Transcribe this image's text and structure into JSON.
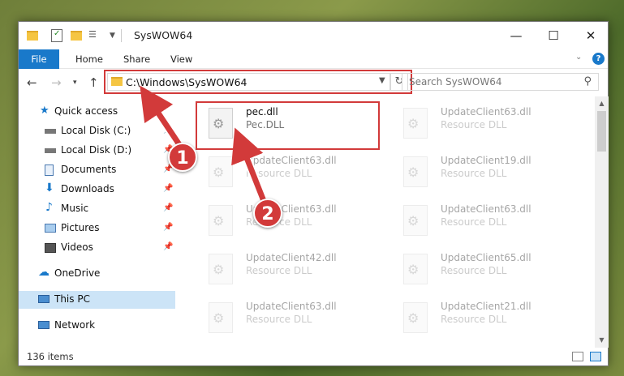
{
  "window": {
    "title": "SysWOW64",
    "minimize": "—",
    "maximize": "☐",
    "close": "✕"
  },
  "ribbon": {
    "tabs": [
      {
        "label": "File"
      },
      {
        "label": "Home"
      },
      {
        "label": "Share"
      },
      {
        "label": "View"
      }
    ]
  },
  "address": {
    "path": "C:\\Windows\\SysWOW64",
    "search_placeholder": "Search SysWOW64"
  },
  "sidebar": {
    "items": [
      {
        "label": "Quick access",
        "icon": "star-icon",
        "pinned": false
      },
      {
        "label": "Local Disk (C:)",
        "icon": "drive-icon",
        "pinned": true
      },
      {
        "label": "Local Disk (D:)",
        "icon": "drive-icon",
        "pinned": true
      },
      {
        "label": "Documents",
        "icon": "documents-icon",
        "pinned": true
      },
      {
        "label": "Downloads",
        "icon": "download-icon",
        "pinned": true
      },
      {
        "label": "Music",
        "icon": "music-icon",
        "pinned": true
      },
      {
        "label": "Pictures",
        "icon": "pictures-icon",
        "pinned": true
      },
      {
        "label": "Videos",
        "icon": "videos-icon",
        "pinned": true
      },
      {
        "label": "OneDrive",
        "icon": "cloud-icon",
        "pinned": false
      },
      {
        "label": "This PC",
        "icon": "computer-icon",
        "pinned": false,
        "selected": true
      },
      {
        "label": "Network",
        "icon": "network-icon",
        "pinned": false
      }
    ]
  },
  "files": [
    {
      "name": "pec.dll",
      "type": "Pec.DLL"
    },
    {
      "name": "UpdateClient63.dll",
      "type": "Resource DLL"
    },
    {
      "name": "UpdateClient63.dll",
      "type": "Resource DLL"
    },
    {
      "name": "UpdateClient19.dll",
      "type": "Resource DLL"
    },
    {
      "name": "UpdateClient63.dll",
      "type": "Resource DLL"
    },
    {
      "name": "UpdateClient63.dll",
      "type": "Resource DLL"
    },
    {
      "name": "UpdateClient42.dll",
      "type": "Resource DLL"
    },
    {
      "name": "UpdateClient65.dll",
      "type": "Resource DLL"
    },
    {
      "name": "UpdateClient63.dll",
      "type": "Resource DLL"
    },
    {
      "name": "UpdateClient21.dll",
      "type": "Resource DLL"
    }
  ],
  "status": {
    "item_count": "136 items"
  },
  "annotations": {
    "step1": "1",
    "step2": "2",
    "highlight_color": "#d23a3a"
  },
  "colors": {
    "accent": "#1979ca",
    "selected_bg": "#cce4f7"
  }
}
